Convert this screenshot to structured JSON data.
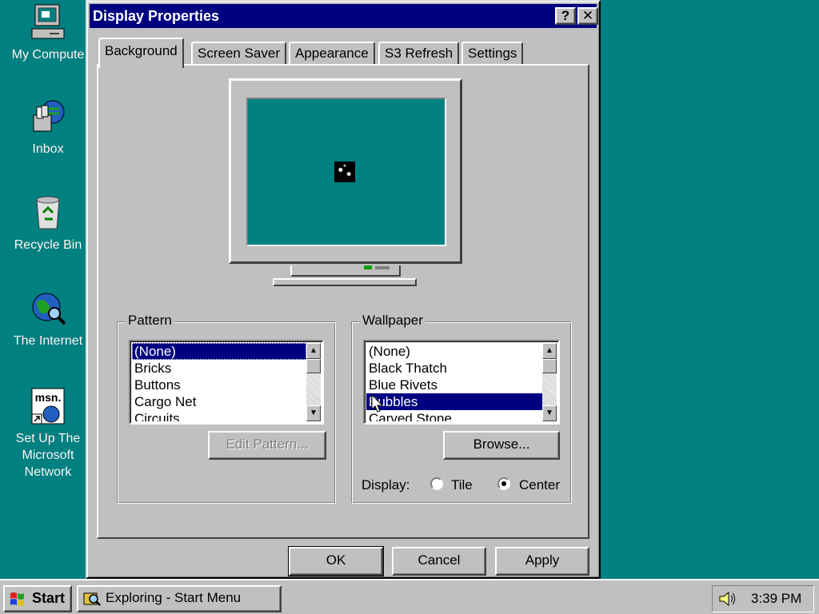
{
  "desktop": {
    "icons": [
      {
        "label": "My Compute",
        "icon": "my-computer-icon"
      },
      {
        "label": "Inbox",
        "icon": "inbox-icon"
      },
      {
        "label": "Recycle Bin",
        "icon": "recycle-bin-icon"
      },
      {
        "label": "The Internet",
        "icon": "internet-icon"
      },
      {
        "label": "Set Up The\nMicrosoft\nNetwork",
        "icon": "msn-icon"
      }
    ]
  },
  "dialog": {
    "title": "Display Properties",
    "help_btn": "?",
    "close_btn": "✕",
    "tabs": [
      "Background",
      "Screen Saver",
      "Appearance",
      "S3 Refresh",
      "Settings"
    ],
    "active_tab": "Background",
    "pattern": {
      "label": "Pattern",
      "items": [
        "(None)",
        "Bricks",
        "Buttons",
        "Cargo Net",
        "Circuits"
      ],
      "selected": "(None)",
      "edit_button": "Edit Pattern..."
    },
    "wallpaper": {
      "label": "Wallpaper",
      "items": [
        "(None)",
        "Black Thatch",
        "Blue Rivets",
        "Bubbles",
        "Carved Stone"
      ],
      "selected": "Bubbles",
      "browse_button": "Browse...",
      "display_label": "Display:",
      "tile_label": "Tile",
      "center_label": "Center",
      "display_mode": "Center"
    },
    "buttons": {
      "ok": "OK",
      "cancel": "Cancel",
      "apply": "Apply"
    }
  },
  "taskbar": {
    "start_label": "Start",
    "task_label": "Exploring - Start Menu",
    "clock": "3:39 PM"
  },
  "colors": {
    "desktop": "#008080",
    "titlebar": "#000080",
    "face": "#c0c0c0",
    "selection": "#000080"
  }
}
